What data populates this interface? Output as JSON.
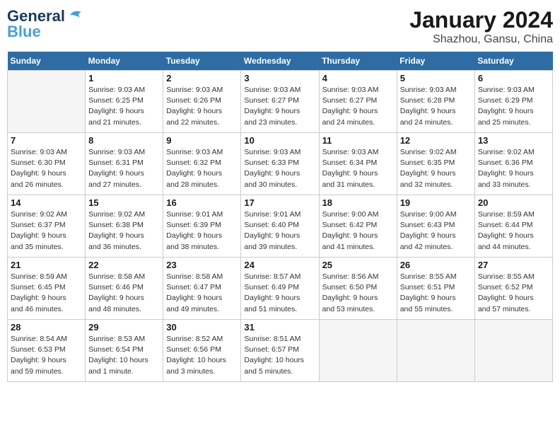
{
  "logo": {
    "line1": "General",
    "line2": "Blue"
  },
  "title": "January 2024",
  "subtitle": "Shazhou, Gansu, China",
  "days_of_week": [
    "Sunday",
    "Monday",
    "Tuesday",
    "Wednesday",
    "Thursday",
    "Friday",
    "Saturday"
  ],
  "weeks": [
    [
      {
        "day": "",
        "info": ""
      },
      {
        "day": "1",
        "info": "Sunrise: 9:03 AM\nSunset: 6:25 PM\nDaylight: 9 hours\nand 21 minutes."
      },
      {
        "day": "2",
        "info": "Sunrise: 9:03 AM\nSunset: 6:26 PM\nDaylight: 9 hours\nand 22 minutes."
      },
      {
        "day": "3",
        "info": "Sunrise: 9:03 AM\nSunset: 6:27 PM\nDaylight: 9 hours\nand 23 minutes."
      },
      {
        "day": "4",
        "info": "Sunrise: 9:03 AM\nSunset: 6:27 PM\nDaylight: 9 hours\nand 24 minutes."
      },
      {
        "day": "5",
        "info": "Sunrise: 9:03 AM\nSunset: 6:28 PM\nDaylight: 9 hours\nand 24 minutes."
      },
      {
        "day": "6",
        "info": "Sunrise: 9:03 AM\nSunset: 6:29 PM\nDaylight: 9 hours\nand 25 minutes."
      }
    ],
    [
      {
        "day": "7",
        "info": "Sunrise: 9:03 AM\nSunset: 6:30 PM\nDaylight: 9 hours\nand 26 minutes."
      },
      {
        "day": "8",
        "info": "Sunrise: 9:03 AM\nSunset: 6:31 PM\nDaylight: 9 hours\nand 27 minutes."
      },
      {
        "day": "9",
        "info": "Sunrise: 9:03 AM\nSunset: 6:32 PM\nDaylight: 9 hours\nand 28 minutes."
      },
      {
        "day": "10",
        "info": "Sunrise: 9:03 AM\nSunset: 6:33 PM\nDaylight: 9 hours\nand 30 minutes."
      },
      {
        "day": "11",
        "info": "Sunrise: 9:03 AM\nSunset: 6:34 PM\nDaylight: 9 hours\nand 31 minutes."
      },
      {
        "day": "12",
        "info": "Sunrise: 9:02 AM\nSunset: 6:35 PM\nDaylight: 9 hours\nand 32 minutes."
      },
      {
        "day": "13",
        "info": "Sunrise: 9:02 AM\nSunset: 6:36 PM\nDaylight: 9 hours\nand 33 minutes."
      }
    ],
    [
      {
        "day": "14",
        "info": "Sunrise: 9:02 AM\nSunset: 6:37 PM\nDaylight: 9 hours\nand 35 minutes."
      },
      {
        "day": "15",
        "info": "Sunrise: 9:02 AM\nSunset: 6:38 PM\nDaylight: 9 hours\nand 36 minutes."
      },
      {
        "day": "16",
        "info": "Sunrise: 9:01 AM\nSunset: 6:39 PM\nDaylight: 9 hours\nand 38 minutes."
      },
      {
        "day": "17",
        "info": "Sunrise: 9:01 AM\nSunset: 6:40 PM\nDaylight: 9 hours\nand 39 minutes."
      },
      {
        "day": "18",
        "info": "Sunrise: 9:00 AM\nSunset: 6:42 PM\nDaylight: 9 hours\nand 41 minutes."
      },
      {
        "day": "19",
        "info": "Sunrise: 9:00 AM\nSunset: 6:43 PM\nDaylight: 9 hours\nand 42 minutes."
      },
      {
        "day": "20",
        "info": "Sunrise: 8:59 AM\nSunset: 6:44 PM\nDaylight: 9 hours\nand 44 minutes."
      }
    ],
    [
      {
        "day": "21",
        "info": "Sunrise: 8:59 AM\nSunset: 6:45 PM\nDaylight: 9 hours\nand 46 minutes."
      },
      {
        "day": "22",
        "info": "Sunrise: 8:58 AM\nSunset: 6:46 PM\nDaylight: 9 hours\nand 48 minutes."
      },
      {
        "day": "23",
        "info": "Sunrise: 8:58 AM\nSunset: 6:47 PM\nDaylight: 9 hours\nand 49 minutes."
      },
      {
        "day": "24",
        "info": "Sunrise: 8:57 AM\nSunset: 6:49 PM\nDaylight: 9 hours\nand 51 minutes."
      },
      {
        "day": "25",
        "info": "Sunrise: 8:56 AM\nSunset: 6:50 PM\nDaylight: 9 hours\nand 53 minutes."
      },
      {
        "day": "26",
        "info": "Sunrise: 8:55 AM\nSunset: 6:51 PM\nDaylight: 9 hours\nand 55 minutes."
      },
      {
        "day": "27",
        "info": "Sunrise: 8:55 AM\nSunset: 6:52 PM\nDaylight: 9 hours\nand 57 minutes."
      }
    ],
    [
      {
        "day": "28",
        "info": "Sunrise: 8:54 AM\nSunset: 6:53 PM\nDaylight: 9 hours\nand 59 minutes."
      },
      {
        "day": "29",
        "info": "Sunrise: 8:53 AM\nSunset: 6:54 PM\nDaylight: 10 hours\nand 1 minute."
      },
      {
        "day": "30",
        "info": "Sunrise: 8:52 AM\nSunset: 6:56 PM\nDaylight: 10 hours\nand 3 minutes."
      },
      {
        "day": "31",
        "info": "Sunrise: 8:51 AM\nSunset: 6:57 PM\nDaylight: 10 hours\nand 5 minutes."
      },
      {
        "day": "",
        "info": ""
      },
      {
        "day": "",
        "info": ""
      },
      {
        "day": "",
        "info": ""
      }
    ]
  ]
}
